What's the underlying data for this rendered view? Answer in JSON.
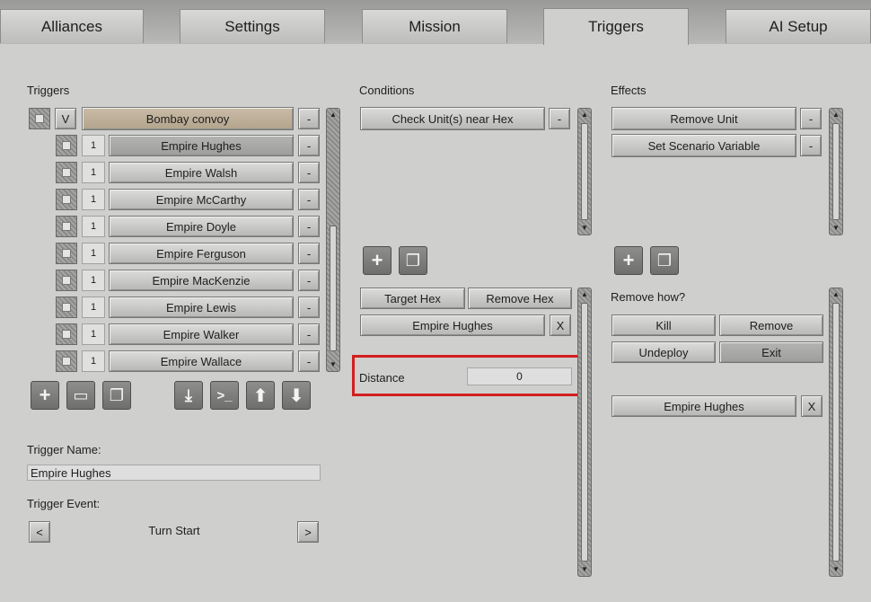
{
  "tabs": [
    "Alliances",
    "Settings",
    "Mission",
    "Triggers",
    "AI Setup"
  ],
  "triggers": {
    "title": "Triggers",
    "group_toggle": "V",
    "group_name": "Bombay convoy",
    "minus": "-",
    "items": [
      {
        "count": "1",
        "name": "Empire Hughes"
      },
      {
        "count": "1",
        "name": "Empire Walsh"
      },
      {
        "count": "1",
        "name": "Empire McCarthy"
      },
      {
        "count": "1",
        "name": "Empire Doyle"
      },
      {
        "count": "1",
        "name": "Empire Ferguson"
      },
      {
        "count": "1",
        "name": "Empire MacKenzie"
      },
      {
        "count": "1",
        "name": "Empire Lewis"
      },
      {
        "count": "1",
        "name": "Empire Walker"
      },
      {
        "count": "1",
        "name": "Empire Wallace"
      }
    ],
    "trigger_name_label": "Trigger Name:",
    "trigger_name_value": "Empire Hughes",
    "trigger_event_label": "Trigger Event:",
    "trigger_event_value": "Turn Start",
    "prev": "<",
    "next": ">"
  },
  "conditions": {
    "title": "Conditions",
    "items": [
      "Check Unit(s) near Hex"
    ],
    "target_hex": "Target Hex",
    "remove_hex": "Remove Hex",
    "unit": "Empire Hughes",
    "clear": "X",
    "distance_label": "Distance",
    "distance_value": "0"
  },
  "effects": {
    "title": "Effects",
    "items": [
      "Remove Unit",
      "Set Scenario Variable"
    ],
    "remove_how_label": "Remove how?",
    "kill": "Kill",
    "remove": "Remove",
    "undeploy": "Undeploy",
    "exit": "Exit",
    "unit": "Empire Hughes",
    "clear": "X"
  },
  "colors": {
    "highlight": "#d21f1f"
  }
}
